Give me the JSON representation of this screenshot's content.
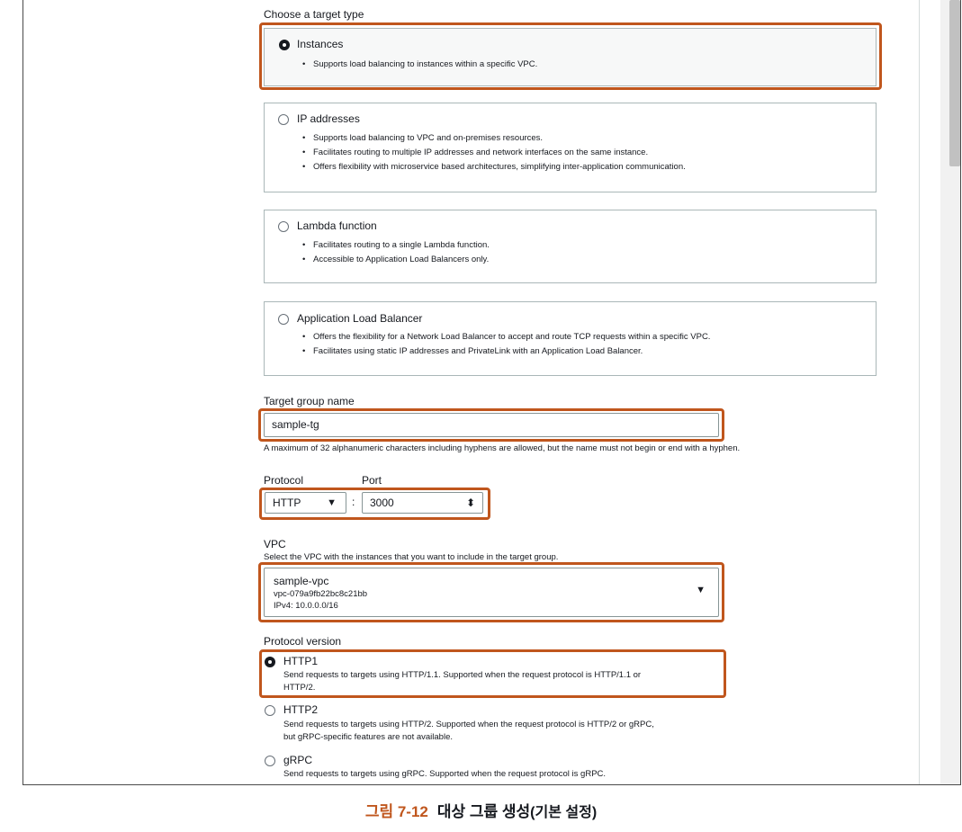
{
  "target_type": {
    "heading": "Choose a target type",
    "options": [
      {
        "title": "Instances",
        "selected": true,
        "bullets": [
          "Supports load balancing to instances within a specific VPC."
        ]
      },
      {
        "title": "IP addresses",
        "selected": false,
        "bullets": [
          "Supports load balancing to VPC and on-premises resources.",
          "Facilitates routing to multiple IP addresses and network interfaces on the same instance.",
          "Offers flexibility with microservice based architectures, simplifying inter-application communication."
        ]
      },
      {
        "title": "Lambda function",
        "selected": false,
        "bullets": [
          "Facilitates routing to a single Lambda function.",
          "Accessible to Application Load Balancers only."
        ]
      },
      {
        "title": "Application Load Balancer",
        "selected": false,
        "bullets": [
          "Offers the flexibility for a Network Load Balancer to accept and route TCP requests within a specific VPC.",
          "Facilitates using static IP addresses and PrivateLink with an Application Load Balancer."
        ]
      }
    ]
  },
  "target_group_name": {
    "label": "Target group name",
    "value": "sample-tg",
    "hint": "A maximum of 32 alphanumeric characters including hyphens are allowed, but the name must not begin or end with a hyphen."
  },
  "protocol": {
    "label": "Protocol",
    "value": "HTTP",
    "separator": ":"
  },
  "port": {
    "label": "Port",
    "value": "3000"
  },
  "vpc": {
    "label": "VPC",
    "description": "Select the VPC with the instances that you want to include in the target group.",
    "name": "sample-vpc",
    "id": "vpc-079a9fb22bc8c21bb",
    "cidr": "IPv4: 10.0.0.0/16"
  },
  "protocol_version": {
    "label": "Protocol version",
    "options": [
      {
        "title": "HTTP1",
        "selected": true,
        "desc1": "Send requests to targets using HTTP/1.1. Supported when the request protocol is HTTP/1.1 or",
        "desc2": "HTTP/2."
      },
      {
        "title": "HTTP2",
        "selected": false,
        "desc1": "Send requests to targets using HTTP/2. Supported when the request protocol is HTTP/2 or gRPC,",
        "desc2": "but gRPC-specific features are not available."
      },
      {
        "title": "gRPC",
        "selected": false,
        "desc1": "Send requests to targets using gRPC. Supported when the request protocol is gRPC.",
        "desc2": ""
      }
    ]
  },
  "caption": {
    "number": "그림 7-12",
    "title": "대상 그룹 생성",
    "paren": "(기본 설정)"
  },
  "colors": {
    "highlight": "#c0561d",
    "border": "#aab7b8",
    "text": "#16191f"
  }
}
